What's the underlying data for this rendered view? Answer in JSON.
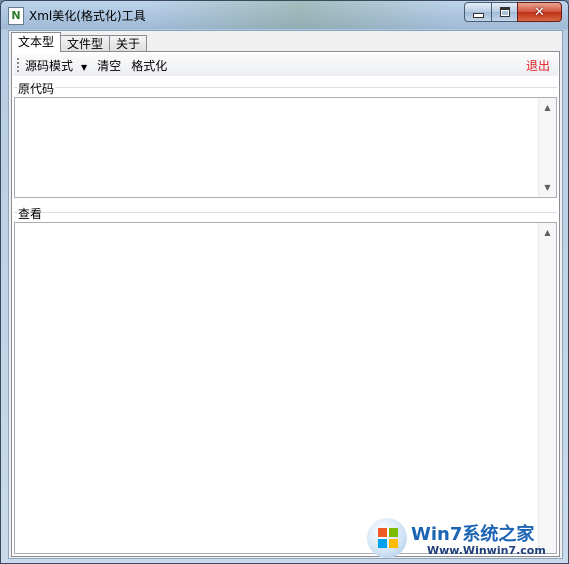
{
  "window": {
    "title": "Xml美化(格式化)工具",
    "min_label": "",
    "close_glyph": "✕"
  },
  "tabs": [
    {
      "label": "文本型",
      "active": true
    },
    {
      "label": "文件型",
      "active": false
    },
    {
      "label": "关于",
      "active": false
    }
  ],
  "toolbar": {
    "mode_label": "源码模式",
    "clear_label": "清空",
    "format_label": "格式化",
    "exit_label": "退出"
  },
  "source": {
    "group_label": "原代码",
    "value": ""
  },
  "view": {
    "group_label": "查看",
    "value": ""
  },
  "watermark": {
    "title": "Win7系统之家",
    "url": "Www.Winwin7.com"
  },
  "colors": {
    "exit_text": "#e02020",
    "close_button": "#c9391f"
  }
}
